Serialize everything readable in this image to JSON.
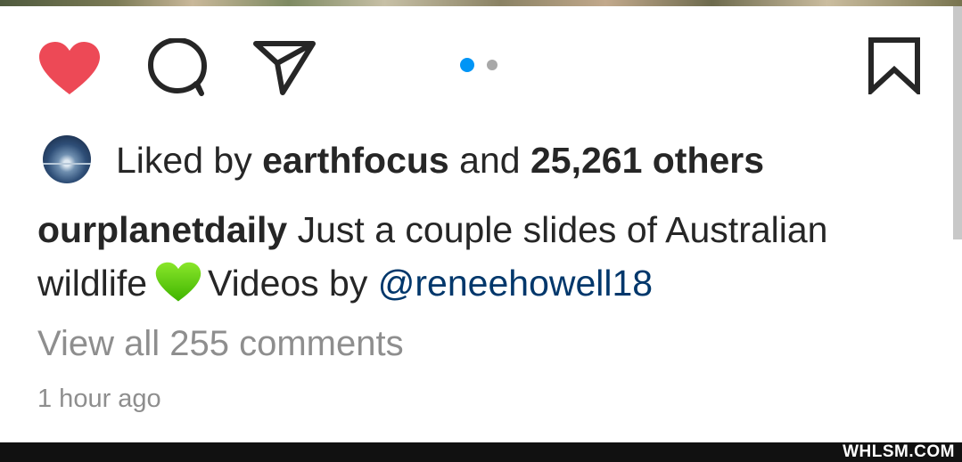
{
  "post": {
    "carousel": {
      "total_slides": 2,
      "current_slide": 1
    },
    "likes": {
      "prefix": "Liked by",
      "user": "earthfocus",
      "joiner": "and",
      "others": "25,261 others"
    },
    "caption": {
      "username": "ourplanetdaily",
      "text_before_emoji": "Just a couple slides of Australian wildlife",
      "emoji": "green-heart-emoji",
      "text_after_emoji": "Videos by",
      "mention": "@reneehowell18"
    },
    "view_comments": "View all 255 comments",
    "timestamp": "1 hour ago",
    "watermark": "WHLSM.COM"
  },
  "icons": {
    "like": "heart-icon",
    "comment": "comment-icon",
    "share": "paper-plane-icon",
    "save": "bookmark-icon"
  },
  "colors": {
    "like_red": "#ed4956",
    "text_dark": "#262626",
    "text_muted": "#8e8e8e",
    "mention_blue": "#00376b",
    "active_dot": "#0095f6",
    "inactive_dot": "#a8a8a8",
    "green_heart": "#5cd100"
  }
}
